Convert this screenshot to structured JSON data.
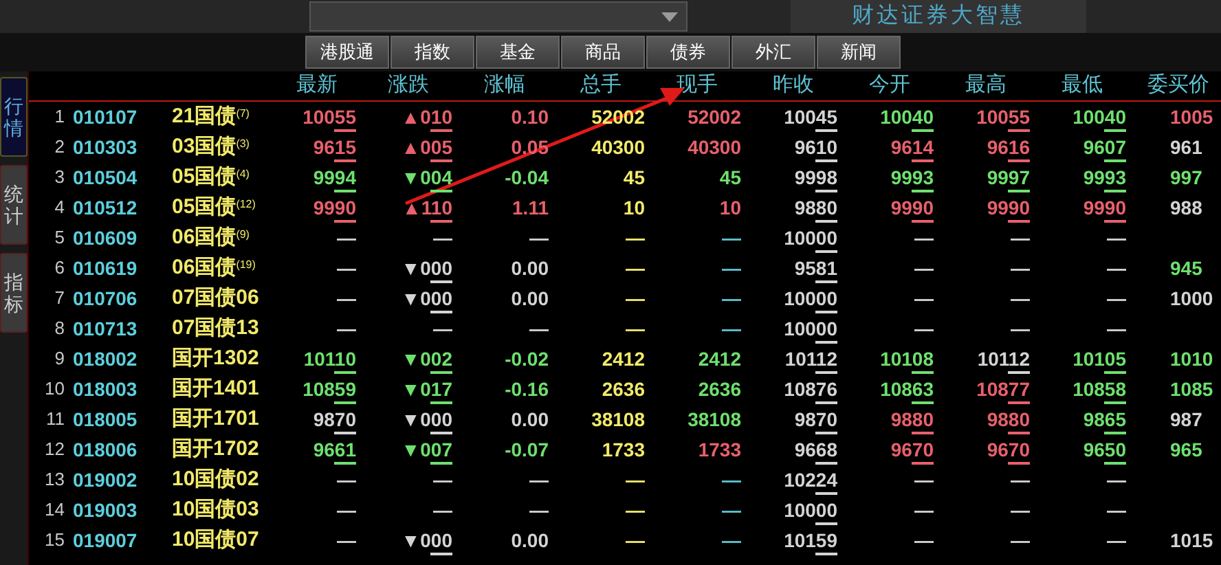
{
  "top_bar": {
    "app_title": "财达证券大智慧"
  },
  "market_tabs": [
    {
      "label": "港股通"
    },
    {
      "label": "指数"
    },
    {
      "label": "基金"
    },
    {
      "label": "商品"
    },
    {
      "label": "债券"
    },
    {
      "label": "外汇"
    },
    {
      "label": "新闻"
    }
  ],
  "side_tabs": [
    {
      "label": "行情",
      "selected": true
    },
    {
      "label": "统计",
      "selected": false
    },
    {
      "label": "指标",
      "selected": false
    }
  ],
  "table": {
    "columns": [
      "最新",
      "涨跌",
      "涨幅",
      "总手",
      "现手",
      "昨收",
      "今开",
      "最高",
      "最低",
      "委买价"
    ],
    "rows": [
      {
        "number": "1",
        "code": "010107",
        "name": "21国债$^{(7)}$",
        "cells": [
          {
            "text": "10055",
            "color": "#e8606c",
            "underlined": true
          },
          {
            "text": "▲010",
            "color": "#e8606c",
            "underlined": true
          },
          {
            "text": "0.10",
            "color": "#e8606c",
            "underlined": false
          },
          {
            "text": "52002",
            "color": "#f2ea6a",
            "underlined": false
          },
          {
            "text": "52002",
            "color": "#e8606c",
            "underlined": false
          },
          {
            "text": "10045",
            "color": "#d4d4d4",
            "underlined": true
          },
          {
            "text": "10040",
            "color": "#6ee06e",
            "underlined": true
          },
          {
            "text": "10055",
            "color": "#e8606c",
            "underlined": true
          },
          {
            "text": "10040",
            "color": "#6ee06e",
            "underlined": true
          },
          {
            "text": "1005",
            "color": "#e8606c",
            "underlined": false
          }
        ]
      },
      {
        "number": "2",
        "code": "010303",
        "name": "03国债$^{(3)}$",
        "cells": [
          {
            "text": "9615",
            "color": "#e8606c",
            "underlined": true
          },
          {
            "text": "▲005",
            "color": "#e8606c",
            "underlined": true
          },
          {
            "text": "0.05",
            "color": "#e8606c",
            "underlined": false
          },
          {
            "text": "40300",
            "color": "#f2ea6a",
            "underlined": false
          },
          {
            "text": "40300",
            "color": "#e8606c",
            "underlined": false
          },
          {
            "text": "9610",
            "color": "#d4d4d4",
            "underlined": true
          },
          {
            "text": "9614",
            "color": "#e8606c",
            "underlined": true
          },
          {
            "text": "9616",
            "color": "#e8606c",
            "underlined": true
          },
          {
            "text": "9607",
            "color": "#6ee06e",
            "underlined": true
          },
          {
            "text": "961",
            "color": "#d4d4d4",
            "underlined": false
          }
        ]
      },
      {
        "number": "3",
        "code": "010504",
        "name": "05国债$^{(4)}$",
        "cells": [
          {
            "text": "9994",
            "color": "#6ee06e",
            "underlined": true
          },
          {
            "text": "▼004",
            "color": "#6ee06e",
            "underlined": true
          },
          {
            "text": "-0.04",
            "color": "#6ee06e",
            "underlined": false
          },
          {
            "text": "45",
            "color": "#f2ea6a",
            "underlined": false
          },
          {
            "text": "45",
            "color": "#6ee06e",
            "underlined": false
          },
          {
            "text": "9998",
            "color": "#d4d4d4",
            "underlined": true
          },
          {
            "text": "9993",
            "color": "#6ee06e",
            "underlined": true
          },
          {
            "text": "9997",
            "color": "#6ee06e",
            "underlined": true
          },
          {
            "text": "9993",
            "color": "#6ee06e",
            "underlined": true
          },
          {
            "text": "997",
            "color": "#6ee06e",
            "underlined": false
          }
        ]
      },
      {
        "number": "4",
        "code": "010512",
        "name": "05国债$^{(12)}$",
        "cells": [
          {
            "text": "9990",
            "color": "#e8606c",
            "underlined": true
          },
          {
            "text": "▲110",
            "color": "#e8606c",
            "underlined": true
          },
          {
            "text": "1.11",
            "color": "#e8606c",
            "underlined": false
          },
          {
            "text": "10",
            "color": "#f2ea6a",
            "underlined": false
          },
          {
            "text": "10",
            "color": "#e8606c",
            "underlined": false
          },
          {
            "text": "9880",
            "color": "#d4d4d4",
            "underlined": true
          },
          {
            "text": "9990",
            "color": "#e8606c",
            "underlined": true
          },
          {
            "text": "9990",
            "color": "#e8606c",
            "underlined": true
          },
          {
            "text": "9990",
            "color": "#e8606c",
            "underlined": true
          },
          {
            "text": "988",
            "color": "#d4d4d4",
            "underlined": false
          }
        ]
      },
      {
        "number": "5",
        "code": "010609",
        "name": "06国债$^{(9)}$",
        "cells": [
          {
            "text": "—",
            "color": "#d4d4d4",
            "underlined": false
          },
          {
            "text": "—",
            "color": "#d4d4d4",
            "underlined": false
          },
          {
            "text": "—",
            "color": "#d4d4d4",
            "underlined": false
          },
          {
            "text": "—",
            "color": "#f2ea6a",
            "underlined": false
          },
          {
            "text": "—",
            "color": "#5ec4d4",
            "underlined": false
          },
          {
            "text": "10000",
            "color": "#d4d4d4",
            "underlined": true
          },
          {
            "text": "—",
            "color": "#d4d4d4",
            "underlined": false
          },
          {
            "text": "—",
            "color": "#d4d4d4",
            "underlined": false
          },
          {
            "text": "—",
            "color": "#d4d4d4",
            "underlined": false
          },
          null
        ]
      },
      {
        "number": "6",
        "code": "010619",
        "name": "06国债$^{(19)}$",
        "cells": [
          {
            "text": "—",
            "color": "#d4d4d4",
            "underlined": false
          },
          {
            "text": "▼000",
            "color": "#d4d4d4",
            "underlined": true
          },
          {
            "text": "0.00",
            "color": "#d4d4d4",
            "underlined": false
          },
          {
            "text": "—",
            "color": "#f2ea6a",
            "underlined": false
          },
          {
            "text": "—",
            "color": "#5ec4d4",
            "underlined": false
          },
          {
            "text": "9581",
            "color": "#d4d4d4",
            "underlined": true
          },
          {
            "text": "—",
            "color": "#d4d4d4",
            "underlined": false
          },
          {
            "text": "—",
            "color": "#d4d4d4",
            "underlined": false
          },
          {
            "text": "—",
            "color": "#d4d4d4",
            "underlined": false
          },
          {
            "text": "945",
            "color": "#6ee06e",
            "underlined": false
          }
        ]
      },
      {
        "number": "7",
        "code": "010706",
        "name": "07国债06",
        "cells": [
          {
            "text": "—",
            "color": "#d4d4d4",
            "underlined": false
          },
          {
            "text": "▼000",
            "color": "#d4d4d4",
            "underlined": true
          },
          {
            "text": "0.00",
            "color": "#d4d4d4",
            "underlined": false
          },
          {
            "text": "—",
            "color": "#f2ea6a",
            "underlined": false
          },
          {
            "text": "—",
            "color": "#5ec4d4",
            "underlined": false
          },
          {
            "text": "10000",
            "color": "#d4d4d4",
            "underlined": true
          },
          {
            "text": "—",
            "color": "#d4d4d4",
            "underlined": false
          },
          {
            "text": "—",
            "color": "#d4d4d4",
            "underlined": false
          },
          {
            "text": "—",
            "color": "#d4d4d4",
            "underlined": false
          },
          {
            "text": "1000",
            "color": "#d4d4d4",
            "underlined": false
          }
        ]
      },
      {
        "number": "8",
        "code": "010713",
        "name": "07国债13",
        "cells": [
          {
            "text": "—",
            "color": "#d4d4d4",
            "underlined": false
          },
          {
            "text": "—",
            "color": "#d4d4d4",
            "underlined": false
          },
          {
            "text": "—",
            "color": "#d4d4d4",
            "underlined": false
          },
          {
            "text": "—",
            "color": "#f2ea6a",
            "underlined": false
          },
          {
            "text": "—",
            "color": "#5ec4d4",
            "underlined": false
          },
          {
            "text": "10000",
            "color": "#d4d4d4",
            "underlined": true
          },
          {
            "text": "—",
            "color": "#d4d4d4",
            "underlined": false
          },
          {
            "text": "—",
            "color": "#d4d4d4",
            "underlined": false
          },
          {
            "text": "—",
            "color": "#d4d4d4",
            "underlined": false
          },
          null
        ]
      },
      {
        "number": "9",
        "code": "018002",
        "name": "国开1302",
        "cells": [
          {
            "text": "10110",
            "color": "#6ee06e",
            "underlined": true
          },
          {
            "text": "▼002",
            "color": "#6ee06e",
            "underlined": true
          },
          {
            "text": "-0.02",
            "color": "#6ee06e",
            "underlined": false
          },
          {
            "text": "2412",
            "color": "#f2ea6a",
            "underlined": false
          },
          {
            "text": "2412",
            "color": "#6ee06e",
            "underlined": false
          },
          {
            "text": "10112",
            "color": "#d4d4d4",
            "underlined": true
          },
          {
            "text": "10108",
            "color": "#6ee06e",
            "underlined": true
          },
          {
            "text": "10112",
            "color": "#d4d4d4",
            "underlined": true
          },
          {
            "text": "10105",
            "color": "#6ee06e",
            "underlined": true
          },
          {
            "text": "1010",
            "color": "#6ee06e",
            "underlined": false
          }
        ]
      },
      {
        "number": "10",
        "code": "018003",
        "name": "国开1401",
        "cells": [
          {
            "text": "10859",
            "color": "#6ee06e",
            "underlined": true
          },
          {
            "text": "▼017",
            "color": "#6ee06e",
            "underlined": true
          },
          {
            "text": "-0.16",
            "color": "#6ee06e",
            "underlined": false
          },
          {
            "text": "2636",
            "color": "#f2ea6a",
            "underlined": false
          },
          {
            "text": "2636",
            "color": "#6ee06e",
            "underlined": false
          },
          {
            "text": "10876",
            "color": "#d4d4d4",
            "underlined": true
          },
          {
            "text": "10863",
            "color": "#6ee06e",
            "underlined": true
          },
          {
            "text": "10877",
            "color": "#e8606c",
            "underlined": true
          },
          {
            "text": "10858",
            "color": "#6ee06e",
            "underlined": true
          },
          {
            "text": "1085",
            "color": "#6ee06e",
            "underlined": false
          }
        ]
      },
      {
        "number": "11",
        "code": "018005",
        "name": "国开1701",
        "cells": [
          {
            "text": "9870",
            "color": "#d4d4d4",
            "underlined": true
          },
          {
            "text": "▼000",
            "color": "#d4d4d4",
            "underlined": true
          },
          {
            "text": "0.00",
            "color": "#d4d4d4",
            "underlined": false
          },
          {
            "text": "38108",
            "color": "#f2ea6a",
            "underlined": false
          },
          {
            "text": "38108",
            "color": "#6ee06e",
            "underlined": false
          },
          {
            "text": "9870",
            "color": "#d4d4d4",
            "underlined": true
          },
          {
            "text": "9880",
            "color": "#e8606c",
            "underlined": true
          },
          {
            "text": "9880",
            "color": "#e8606c",
            "underlined": true
          },
          {
            "text": "9865",
            "color": "#6ee06e",
            "underlined": true
          },
          {
            "text": "987",
            "color": "#d4d4d4",
            "underlined": false
          }
        ]
      },
      {
        "number": "12",
        "code": "018006",
        "name": "国开1702",
        "cells": [
          {
            "text": "9661",
            "color": "#6ee06e",
            "underlined": true
          },
          {
            "text": "▼007",
            "color": "#6ee06e",
            "underlined": true
          },
          {
            "text": "-0.07",
            "color": "#6ee06e",
            "underlined": false
          },
          {
            "text": "1733",
            "color": "#f2ea6a",
            "underlined": false
          },
          {
            "text": "1733",
            "color": "#e8606c",
            "underlined": false
          },
          {
            "text": "9668",
            "color": "#d4d4d4",
            "underlined": true
          },
          {
            "text": "9670",
            "color": "#e8606c",
            "underlined": true
          },
          {
            "text": "9670",
            "color": "#e8606c",
            "underlined": true
          },
          {
            "text": "9650",
            "color": "#6ee06e",
            "underlined": true
          },
          {
            "text": "965",
            "color": "#6ee06e",
            "underlined": false
          }
        ]
      },
      {
        "number": "13",
        "code": "019002",
        "name": "10国债02",
        "cells": [
          {
            "text": "—",
            "color": "#d4d4d4",
            "underlined": false
          },
          {
            "text": "—",
            "color": "#d4d4d4",
            "underlined": false
          },
          {
            "text": "—",
            "color": "#d4d4d4",
            "underlined": false
          },
          {
            "text": "—",
            "color": "#f2ea6a",
            "underlined": false
          },
          {
            "text": "—",
            "color": "#5ec4d4",
            "underlined": false
          },
          {
            "text": "10224",
            "color": "#d4d4d4",
            "underlined": true
          },
          {
            "text": "—",
            "color": "#d4d4d4",
            "underlined": false
          },
          {
            "text": "—",
            "color": "#d4d4d4",
            "underlined": false
          },
          {
            "text": "—",
            "color": "#d4d4d4",
            "underlined": false
          },
          null
        ]
      },
      {
        "number": "14",
        "code": "019003",
        "name": "10国债03",
        "cells": [
          {
            "text": "—",
            "color": "#d4d4d4",
            "underlined": false
          },
          {
            "text": "—",
            "color": "#d4d4d4",
            "underlined": false
          },
          {
            "text": "—",
            "color": "#d4d4d4",
            "underlined": false
          },
          {
            "text": "—",
            "color": "#f2ea6a",
            "underlined": false
          },
          {
            "text": "—",
            "color": "#5ec4d4",
            "underlined": false
          },
          {
            "text": "10000",
            "color": "#d4d4d4",
            "underlined": true
          },
          {
            "text": "—",
            "color": "#d4d4d4",
            "underlined": false
          },
          {
            "text": "—",
            "color": "#d4d4d4",
            "underlined": false
          },
          {
            "text": "—",
            "color": "#d4d4d4",
            "underlined": false
          },
          null
        ]
      },
      {
        "number": "15",
        "code": "019007",
        "name": "10国债07",
        "cells": [
          {
            "text": "—",
            "color": "#d4d4d4",
            "underlined": false
          },
          {
            "text": "▼000",
            "color": "#d4d4d4",
            "underlined": true
          },
          {
            "text": "0.00",
            "color": "#d4d4d4",
            "underlined": false
          },
          {
            "text": "—",
            "color": "#f2ea6a",
            "underlined": false
          },
          {
            "text": "—",
            "color": "#5ec4d4",
            "underlined": false
          },
          {
            "text": "10159",
            "color": "#d4d4d4",
            "underlined": true
          },
          {
            "text": "—",
            "color": "#d4d4d4",
            "underlined": false
          },
          {
            "text": "—",
            "color": "#d4d4d4",
            "underlined": false
          },
          {
            "text": "—",
            "color": "#d4d4d4",
            "underlined": false
          },
          {
            "text": "1015",
            "color": "#d4d4d4",
            "underlined": false
          }
        ]
      }
    ]
  }
}
